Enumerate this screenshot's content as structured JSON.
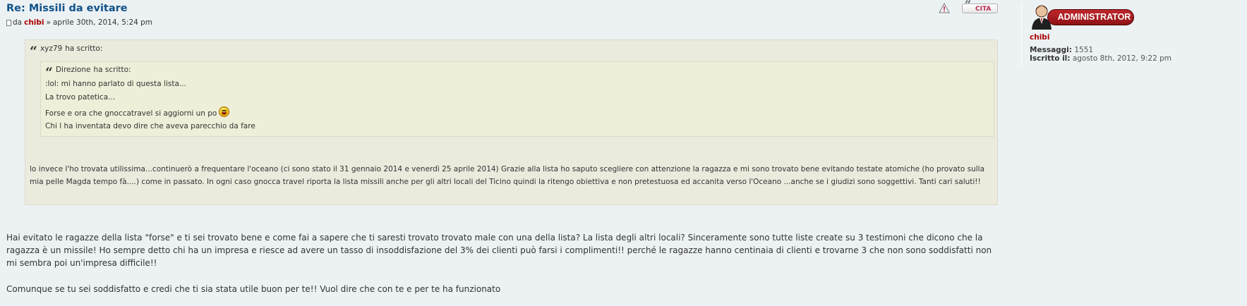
{
  "post": {
    "title": "Re: Missili da evitare",
    "by_prefix": "da",
    "author": "chibi",
    "separator": "»",
    "date": "aprile 30th, 2014, 5:24 pm"
  },
  "buttons": {
    "report_icon": "warning-icon",
    "quote_label": "CITA"
  },
  "outer_quote": {
    "cite_author": "xyz79",
    "cite_suffix": "ha scritto:",
    "inner_quote": {
      "cite_author": "Direzione",
      "cite_suffix": "ha scritto:",
      "lines": [
        ":lol: mi hanno parlato di questa lista...",
        "La trovo patetica...",
        "Forse e ora che gnoccatravel si aggiorni un po",
        "Chi l ha inventata devo dire che aveva parecchio da fare"
      ],
      "smiley": "laughing-smiley"
    },
    "body": "lo invece l'ho trovata utilissima...continuerò a frequentare l'oceano (ci sono stato il 31 gennaio 2014 e venerdì 25 aprile 2014) Grazie alla lista ho saputo scegliere con attenzione la ragazza e mi sono trovato bene evitando testate atomiche (ho provato sulla mia pelle Magda tempo fà....) come in passato. In ogni caso gnocca travel riporta la lista missili anche per gli altri locali del Ticino quindi la ritengo obiettiva e non pretestuosa ed accanita verso l'Oceano ...anche se i giudizi sono soggettivi. Tanti cari saluti!!"
  },
  "reply": {
    "paragraph1": "Hai evitato le ragazze della lista \"forse\" e ti sei trovato bene e come fai a sapere che ti saresti trovato trovato male con una della lista? La lista degli altri locali? Sinceramente sono tutte liste create su 3 testimoni che dicono che la ragazza è un missile! Ho sempre detto chi ha un impresa e riesce ad avere un tasso di insoddisfazione del 3% dei clienti può farsi i complimenti!! perché le ragazze hanno centinaia di clienti e trovarne 3 che non sono soddisfatti non mi sembra poi un'impresa difficile!!",
    "paragraph2": "Comunque se tu sei soddisfatto e credi che ti sia stata utile buon per te!! Vuol dire che con te e per te ha funzionato"
  },
  "profile": {
    "rank": "ADMINISTRATOR",
    "username": "chibi",
    "posts_label": "Messaggi:",
    "posts_value": "1551",
    "joined_label": "Iscritto il:",
    "joined_value": "agosto 8th, 2012, 9:22 pm"
  },
  "colors": {
    "title": "#105289",
    "author": "#aa0000",
    "rank_badge": "#c0262b",
    "quote_bg": "#ebeadd",
    "page_bg": "#ecf1f3"
  }
}
